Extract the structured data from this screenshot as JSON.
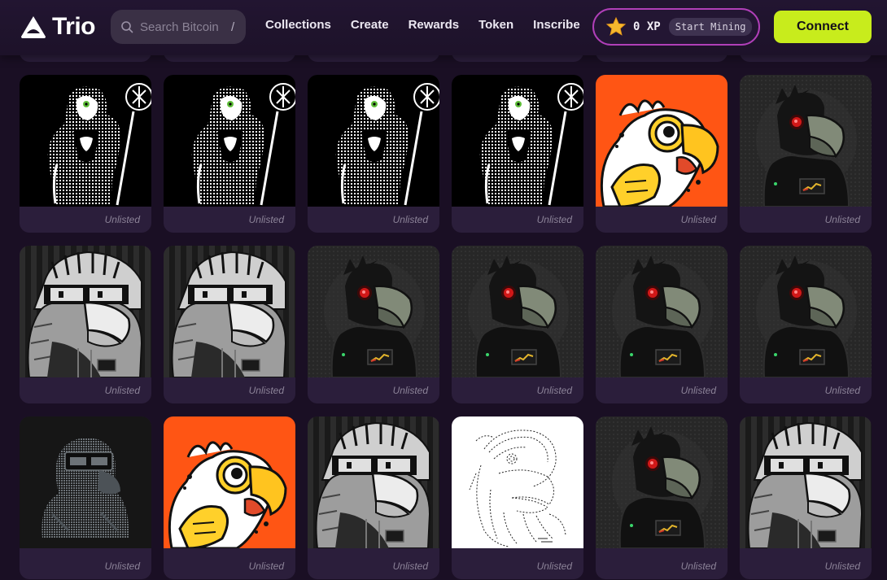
{
  "header": {
    "logo_text": "Trio",
    "search": {
      "placeholder": "Search Bitcoin",
      "shortcut": "/"
    },
    "nav": [
      "Collections",
      "Create",
      "Rewards",
      "Token",
      "Inscribe"
    ],
    "xp": {
      "icon": "star-icon",
      "label": "0 XP",
      "mining_label": "Start Mining"
    },
    "connect_label": "Connect"
  },
  "colors": {
    "accent": "#c8ec1c",
    "pill_border": "#b03fb8",
    "background": "#1a0f24",
    "card": "#2b1e3b"
  },
  "grid": {
    "rows": [
      {
        "cards": [
          {
            "art": "bw-mage-bird",
            "status": "Unlisted"
          },
          {
            "art": "bw-mage-bird",
            "status": "Unlisted"
          },
          {
            "art": "bw-mage-bird",
            "status": "Unlisted"
          },
          {
            "art": "bw-mage-bird",
            "status": "Unlisted"
          },
          {
            "art": "cartoon-parrot-orange",
            "status": "Unlisted"
          },
          {
            "art": "robot-crow",
            "status": "Unlisted"
          }
        ]
      },
      {
        "cards": [
          {
            "art": "punk-eagle-glasses",
            "status": "Unlisted"
          },
          {
            "art": "punk-eagle-glasses",
            "status": "Unlisted"
          },
          {
            "art": "robot-crow",
            "status": "Unlisted"
          },
          {
            "art": "robot-crow",
            "status": "Unlisted"
          },
          {
            "art": "robot-crow",
            "status": "Unlisted"
          },
          {
            "art": "robot-crow",
            "status": "Unlisted"
          }
        ]
      },
      {
        "cards": [
          {
            "art": "dim-vr-bird",
            "status": "Unlisted"
          },
          {
            "art": "cartoon-parrot-orange",
            "status": "Unlisted"
          },
          {
            "art": "punk-eagle-glasses",
            "status": "Unlisted"
          },
          {
            "art": "sketch-eagle-white",
            "status": "Unlisted"
          },
          {
            "art": "robot-crow",
            "status": "Unlisted"
          },
          {
            "art": "punk-eagle-glasses",
            "status": "Unlisted"
          }
        ]
      }
    ]
  }
}
